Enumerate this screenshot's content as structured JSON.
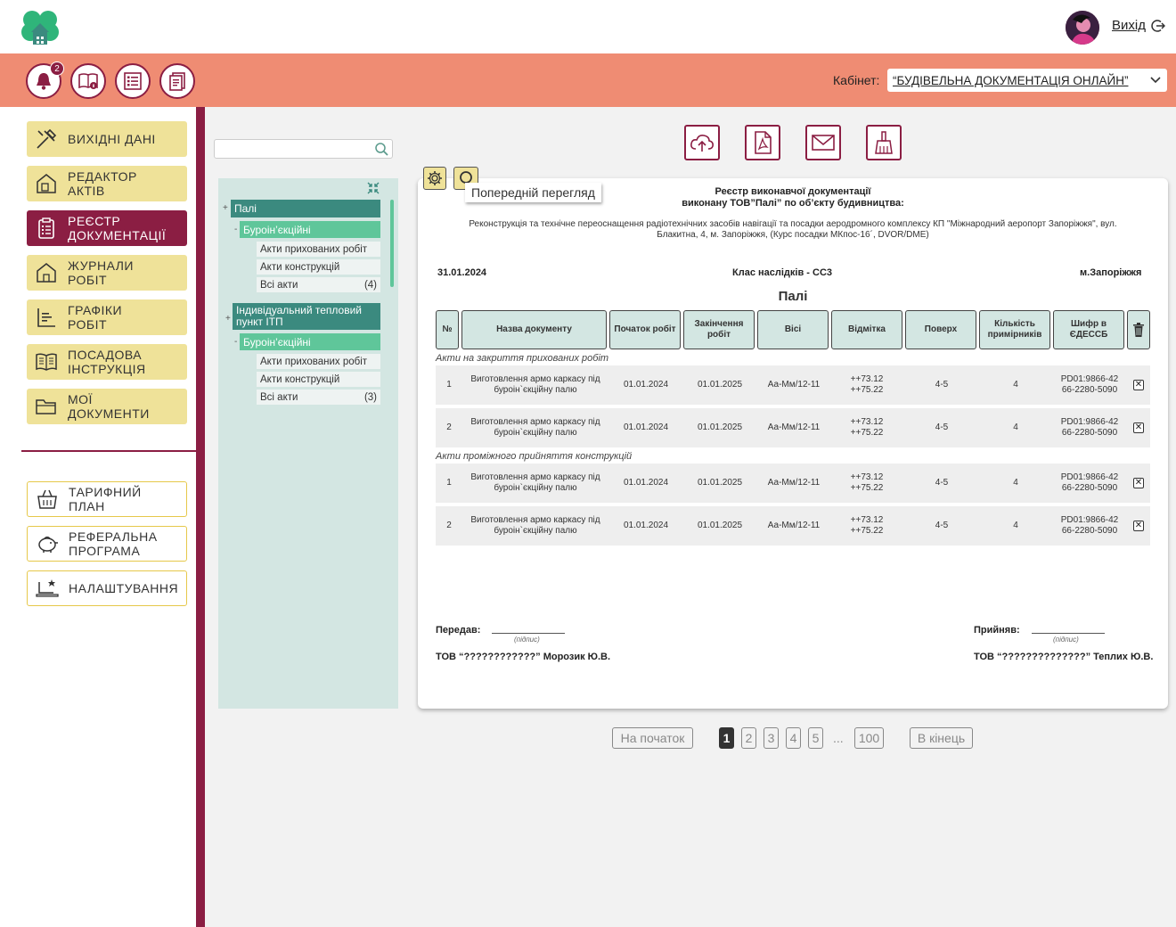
{
  "header": {
    "logout_label": "Вихід",
    "cabinet_label": "Кабінет:",
    "cabinet_value": "“БУДІВЕЛЬНА ДОКУМЕНТАЦІЯ ОНЛАЙН”",
    "notifications_count": "2"
  },
  "sidebar": {
    "items": [
      {
        "label": "ВИХІДНІ ДАНІ",
        "icon": "tools-icon"
      },
      {
        "label": "РЕДАКТОР АКТІВ",
        "icon": "doc-editor-icon"
      },
      {
        "label": "РЕЄСТР ДОКУМЕНТАЦІЇ",
        "icon": "clipboard-icon",
        "active": true
      },
      {
        "label": "ЖУРНАЛИ РОБІТ",
        "icon": "house-doc-icon"
      },
      {
        "label": "ГРАФІКИ РОБІТ",
        "icon": "chart-icon"
      },
      {
        "label": "ПОСАДОВА ІНСТРУКЦІЯ",
        "icon": "book-icon"
      },
      {
        "label": "МОЇ ДОКУМЕНТИ",
        "icon": "folder-icon"
      }
    ],
    "bottom_items": [
      {
        "label": "ТАРИФНИЙ ПЛАН",
        "icon": "basket-icon"
      },
      {
        "label": "РЕФЕРАЛЬНА ПРОГРАМА",
        "icon": "piggy-bank-icon"
      },
      {
        "label": "НАЛАШТУВАННЯ",
        "icon": "laptop-settings-icon"
      }
    ]
  },
  "tree": {
    "search_placeholder": "",
    "groups": [
      {
        "label": "Палі",
        "sub": "Буроін’єкційні",
        "leaves": [
          {
            "label": "Акти прихованих робіт",
            "count": ""
          },
          {
            "label": "Акти конструкцій",
            "count": ""
          },
          {
            "label": "Всі акти",
            "count": "(4)"
          }
        ]
      },
      {
        "label": "Індивідуальний тепловий пункт ІТП",
        "sub": "Буроін’єкційні",
        "leaves": [
          {
            "label": "Акти прихованих робіт",
            "count": ""
          },
          {
            "label": "Акти конструкцій",
            "count": ""
          },
          {
            "label": "Всі акти",
            "count": "(3)"
          }
        ]
      }
    ]
  },
  "toolbar": {
    "tooltip": "Попередній перегляд"
  },
  "document": {
    "title_line1": "Реєстр виконавчої документації",
    "title_line2": "виконану ТОВ”Палі” по об’єкту будивництва:",
    "subtitle": "Реконструкція та технічне переоснащення радіотехнічних засобів навігації та посадки аеродромного комплексу КП \"Міжнародний аеропорт Запоріжжя\", вул. Блакитна, 4, м. Запоріжжя, (Курс посадки МКпос-16´, DVOR/DME)",
    "date": "31.01.2024",
    "class": "Клас наслідків - СС3",
    "city": "м.Запоріжжя",
    "section": "Палі",
    "columns": [
      "№",
      "Назва документу",
      "Початок робіт",
      "Закінчення робіт",
      "Вісі",
      "Відмітка",
      "Поверх",
      "Кількість примірників",
      "Шифр в ЄДЕССБ"
    ],
    "groups": [
      {
        "label": "Акти на закриття прихованих робіт",
        "rows": [
          {
            "num": "1",
            "name": "Виготовлення армо каркасу під буроін`єкційну палю",
            "start": "01.01.2024",
            "end": "01.01.2025",
            "axes": "Аа-Мм/12-11",
            "mark": "++73.12 ++75.22",
            "floor": "4-5",
            "copies": "4",
            "code": "PD01:9866-42 66-2280-5090"
          },
          {
            "num": "2",
            "name": "Виготовлення армо каркасу під буроін`єкційну палю",
            "start": "01.01.2024",
            "end": "01.01.2025",
            "axes": "Аа-Мм/12-11",
            "mark": "++73.12 ++75.22",
            "floor": "4-5",
            "copies": "4",
            "code": "PD01:9866-42 66-2280-5090"
          }
        ]
      },
      {
        "label": "Акти проміжного прийняття конструкцій",
        "rows": [
          {
            "num": "1",
            "name": "Виготовлення армо каркасу під буроін`єкційну палю",
            "start": "01.01.2024",
            "end": "01.01.2025",
            "axes": "Аа-Мм/12-11",
            "mark": "++73.12 ++75.22",
            "floor": "4-5",
            "copies": "4",
            "code": "PD01:9866-42 66-2280-5090"
          },
          {
            "num": "2",
            "name": "Виготовлення армо каркасу під буроін`єкційну палю",
            "start": "01.01.2024",
            "end": "01.01.2025",
            "axes": "Аа-Мм/12-11",
            "mark": "++73.12 ++75.22",
            "floor": "4-5",
            "copies": "4",
            "code": "PD01:9866-42 66-2280-5090"
          }
        ]
      }
    ],
    "sign_from_label": "Передав:",
    "sign_to_label": "Прийняв:",
    "sign_hint": "(підпис)",
    "sign_from_name": "ТОВ “????????????” Морозик Ю.В.",
    "sign_to_name": "ТОВ “??????????????” Теплих Ю.В."
  },
  "pagination": {
    "first": "На початок",
    "last": "В кінець",
    "pages": [
      "1",
      "2",
      "3",
      "4",
      "5"
    ],
    "dots": "...",
    "final_page": "100",
    "current": "1"
  },
  "colors": {
    "brand": "#8b1e43",
    "header_bar": "#ef8c73",
    "nav_button": "#efe299",
    "tree_dark": "#3b8a7f",
    "tree_light": "#5fc69a"
  }
}
